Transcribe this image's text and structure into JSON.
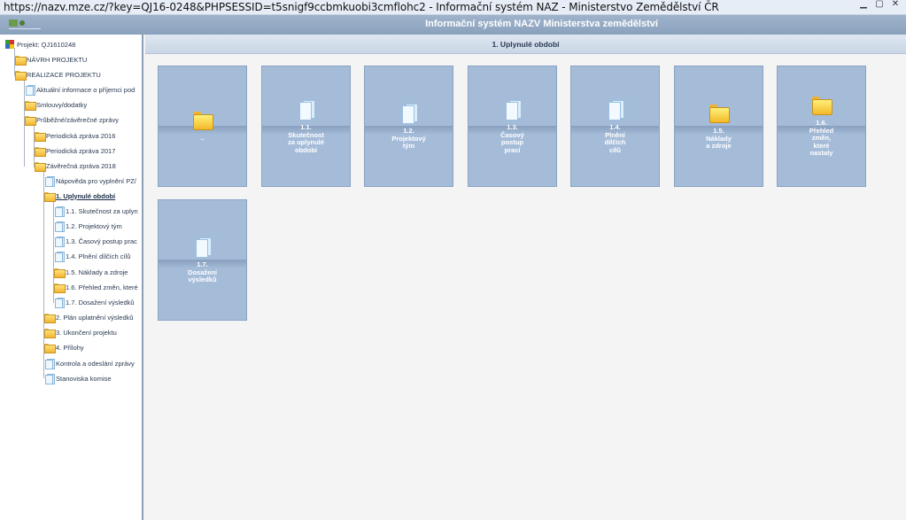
{
  "browser": {
    "title": "https://nazv.mze.cz/?key=QJ16-0248&PHPSESSID=t5snigf9ccbmkuobi3cmflohc2 - Informační systém NAZ - Ministerstvo Zemědělství ČR"
  },
  "app": {
    "title": "Informační systém NAZV Ministerstva zemědělství"
  },
  "sidebar": {
    "items": [
      {
        "label": "Projekt: QJ1610248",
        "icon": "project-icon"
      },
      {
        "label": "NÁVRH PROJEKTU",
        "icon": "folder-icon"
      },
      {
        "label": "REALIZACE PROJEKTU",
        "icon": "folder-icon"
      },
      {
        "label": "Aktuální informace o příjemci pod",
        "icon": "document-icon"
      },
      {
        "label": "Smlouvy/dodatky",
        "icon": "folder-icon"
      },
      {
        "label": "Průběžné/závěrečné zprávy",
        "icon": "folder-icon"
      },
      {
        "label": "Periodická zpráva 2016",
        "icon": "folder-icon"
      },
      {
        "label": "Periodická zpráva 2017",
        "icon": "folder-icon"
      },
      {
        "label": "Závěrečná zpráva 2018",
        "icon": "folder-icon"
      },
      {
        "label": "Nápověda pro vyplnění PZ/",
        "icon": "document-icon"
      },
      {
        "label": "1. Uplynulé období",
        "icon": "folder-icon"
      },
      {
        "label": "1.1. Skutečnost za uplyn",
        "icon": "document-icon"
      },
      {
        "label": "1.2. Projektový tým",
        "icon": "document-icon"
      },
      {
        "label": "1.3. Časový postup prac",
        "icon": "document-icon"
      },
      {
        "label": "1.4. Plnění dílčích cílů",
        "icon": "document-icon"
      },
      {
        "label": "1.5. Náklady a zdroje",
        "icon": "folder-icon"
      },
      {
        "label": "1.6. Přehled změn, které",
        "icon": "folder-icon"
      },
      {
        "label": "1.7. Dosažení výsledků",
        "icon": "document-icon"
      },
      {
        "label": "2. Plán uplatnění výsledků",
        "icon": "folder-icon"
      },
      {
        "label": "3. Ukončení projektu",
        "icon": "folder-icon"
      },
      {
        "label": "4. Přílohy",
        "icon": "folder-icon"
      },
      {
        "label": "Kontrola a odeslání zprávy",
        "icon": "document-icon"
      },
      {
        "label": "Stanoviska komise",
        "icon": "document-icon"
      }
    ]
  },
  "main": {
    "section_title": "1. Uplynulé období",
    "tiles": [
      {
        "label": "..",
        "icon": "folder-icon"
      },
      {
        "label": "1.1.\nSkutečnost\nza uplynulé\nobdobí",
        "icon": "document-icon"
      },
      {
        "label": "1.2.\nProjektový\ntým",
        "icon": "document-icon"
      },
      {
        "label": "1.3.\nČasový\npostup\nprací",
        "icon": "document-icon"
      },
      {
        "label": "1.4.\nPlnění\ndílčích\ncílů",
        "icon": "document-icon"
      },
      {
        "label": "1.5.\nNáklady\na zdroje",
        "icon": "folder-icon"
      },
      {
        "label": "1.6.\nPřehled\nzměn,\nkteré\nnastaly",
        "icon": "folder-icon"
      },
      {
        "label": "1.7.\nDosažení\nvýsledků",
        "icon": "document-icon"
      }
    ]
  },
  "colors": {
    "tile": "#a5bcd9",
    "header": "#8aa1bd",
    "folder": "#f3b928"
  }
}
